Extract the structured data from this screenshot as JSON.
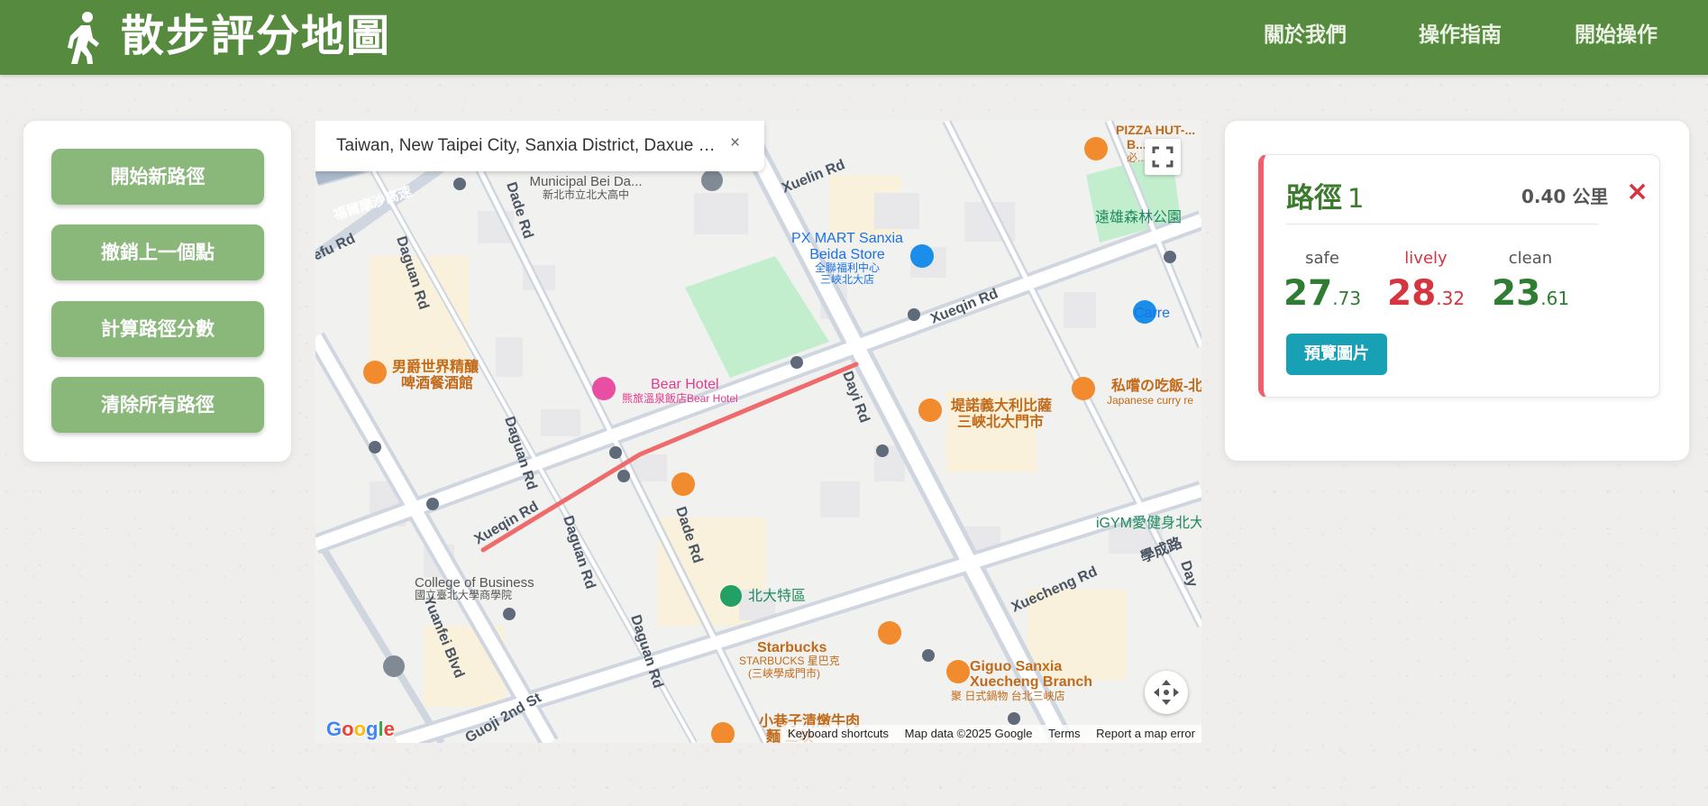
{
  "header": {
    "title": "散步評分地圖",
    "nav": [
      "關於我們",
      "操作指南",
      "開始操作"
    ]
  },
  "sidebar": {
    "buttons": [
      "開始新路徑",
      "撤銷上一個點",
      "計算路徑分數",
      "清除所有路徑"
    ]
  },
  "map": {
    "search_value": "Taiwan, New Taipei City, Sanxia District, Daxue Ro...",
    "clear_label": "×",
    "google_logo": "Google",
    "footer": [
      "Keyboard shortcuts",
      "Map data ©2025 Google",
      "Terms",
      "Report a map error"
    ],
    "streets": [
      "Xuelin Rd",
      "Xueqin Rd",
      "Xueqin Rd",
      "Dayi Rd",
      "Dade Rd",
      "Dade Rd",
      "Daguan Rd",
      "Daguan Rd",
      "Daguan Rd",
      "Daguan Rd",
      "Xuecheng Rd",
      "學成路",
      "Yuanfei Blvd",
      "Guoji 2nd St",
      "efu Rd",
      "福爾摩沙高速",
      "Day"
    ],
    "pois": {
      "municipal": [
        "Municipal Bei Da...",
        "新北市立北大高中"
      ],
      "pxmart": [
        "PX MART Sanxia",
        "Beida Store",
        "全聯福利中心",
        "三峽北大店"
      ],
      "park": "遠雄森林公園",
      "pizza": [
        "PIZZA HUT-...",
        "B...rs",
        "必...HU"
      ],
      "carrefour": "Carre",
      "beer": [
        "男爵世界精釀",
        "啤酒餐酒館"
      ],
      "hotel": [
        "Bear Hotel",
        "熊旅溫泉飯店Bear Hotel"
      ],
      "italian": [
        "堤諾義大利比薩",
        "三峽北大門市"
      ],
      "curry": [
        "私嚐の吃飯-北",
        "Japanese curry re"
      ],
      "college": [
        "College of Business",
        "國立臺北大學商學院"
      ],
      "beida_area": "北大特區",
      "gym": "iGYM愛健身北大",
      "starbucks": [
        "Starbucks",
        "STARBUCKS 星巴克",
        "(三峽學成門市)"
      ],
      "giguo": [
        "Giguo Sanxia",
        "Xuecheng Branch",
        "聚 日式鍋物 台北三峽店"
      ],
      "beef": [
        "小巷子清燉牛肉",
        "麵 三峽"
      ]
    }
  },
  "route_card": {
    "title": "路徑",
    "number": "1",
    "distance": "0.40 公里",
    "close": "×",
    "scores": [
      {
        "label": "safe",
        "int": "27",
        "dec": ".73",
        "color": "#2e7d32"
      },
      {
        "label": "lively",
        "int": "28",
        "dec": ".32",
        "color": "#d6353f"
      },
      {
        "label": "clean",
        "int": "23",
        "dec": ".61",
        "color": "#2e7d32"
      }
    ],
    "preview_button": "預覽圖片"
  },
  "colors": {
    "header_bg": "#568a3e",
    "sidebar_button": "#8ab87b",
    "route_line": "#ef6a6a",
    "preview_button": "#18a0b5",
    "card_accent": "#e8636b"
  }
}
